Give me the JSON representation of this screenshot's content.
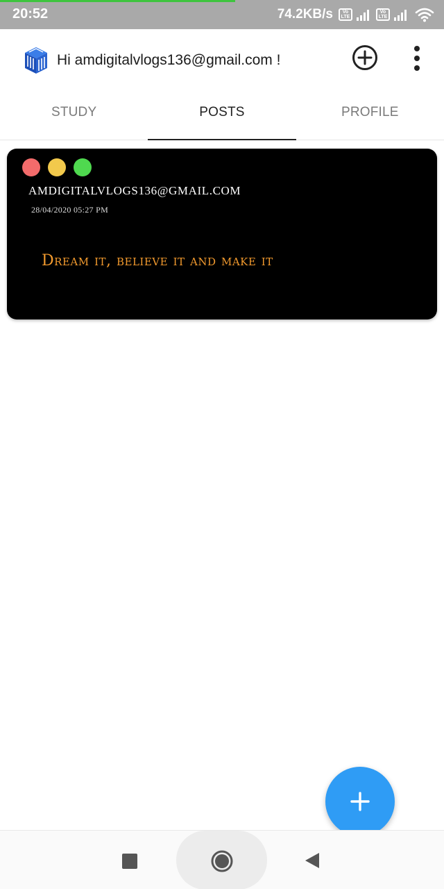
{
  "status_bar": {
    "time": "20:52",
    "network_speed": "74.2KB/s",
    "volte_label_1": "Vo",
    "volte_label_2": "LTE",
    "page_load_progress": 0.53
  },
  "header": {
    "greeting": "Hi amdigitalvlogs136@gmail.com !",
    "add_icon": "plus-circle-icon",
    "menu_icon": "more-vert-icon"
  },
  "tabs": [
    {
      "label": "STUDY",
      "active": false
    },
    {
      "label": "POSTS",
      "active": true
    },
    {
      "label": "PROFILE",
      "active": false
    }
  ],
  "posts": [
    {
      "author": "AMDIGITALVLOGS136@GMAIL.COM",
      "date": "28/04/2020 05:27 PM",
      "message": "Dream it, believe it and make it"
    }
  ],
  "fab": {
    "icon": "plus-icon"
  },
  "navigation": {
    "recents_icon": "square-icon",
    "home_icon": "circle-icon",
    "back_icon": "triangle-back-icon"
  },
  "colors": {
    "status_bar": "#a9a9a9",
    "progress": "#3ec43e",
    "card_bg": "#000000",
    "message_text": "#f29a2e",
    "fab": "#2f9cf5",
    "dot_red": "#f36b6b",
    "dot_yellow": "#f2c94c",
    "dot_green": "#4fd94f"
  }
}
